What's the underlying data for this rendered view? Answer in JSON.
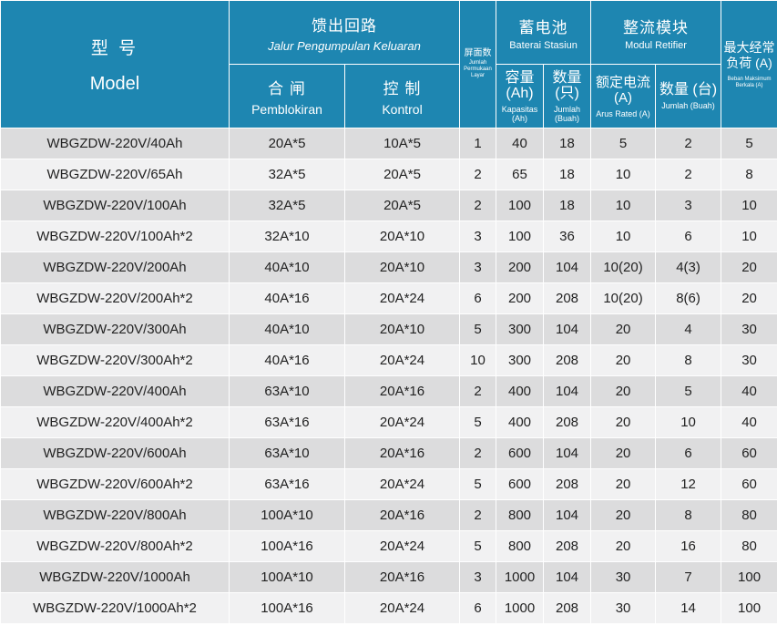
{
  "header": {
    "model_zh": "型 号",
    "model_en": "Model",
    "feeder_zh": "馈出回路",
    "feeder_en": "Jalur Pengumpulan Keluaran",
    "closing_zh": "合 闸",
    "closing_en": "Pemblokiran",
    "control_zh": "控 制",
    "control_en": "Kontrol",
    "panels_zh": "屏面数",
    "panels_en": "Jumlah Permukaan Layar",
    "battery_zh": "蓄电池",
    "battery_en": "Baterai Stasiun",
    "capacity_zh": "容量 (Ah)",
    "capacity_en": "Kapasitas (Ah)",
    "bat_qty_zh": "数量 (只)",
    "bat_qty_en": "Jumlah (Buah)",
    "rectifier_zh": "整流模块",
    "rectifier_en": "Modul Retifier",
    "rated_zh": "额定电流 (A)",
    "rated_en": "Arus Rated (A)",
    "rect_qty_zh": "数量 (台)",
    "rect_qty_en": "Jumlah (Buah)",
    "maxload_zh": "最大经常负荷 (A)",
    "maxload_en": "Beban Maksimum Berkala (A)"
  },
  "rows": [
    [
      "WBGZDW-220V/40Ah",
      "20A*5",
      "10A*5",
      "1",
      "40",
      "18",
      "5",
      "2",
      "5"
    ],
    [
      "WBGZDW-220V/65Ah",
      "32A*5",
      "20A*5",
      "2",
      "65",
      "18",
      "10",
      "2",
      "8"
    ],
    [
      "WBGZDW-220V/100Ah",
      "32A*5",
      "20A*5",
      "2",
      "100",
      "18",
      "10",
      "3",
      "10"
    ],
    [
      "WBGZDW-220V/100Ah*2",
      "32A*10",
      "20A*10",
      "3",
      "100",
      "36",
      "10",
      "6",
      "10"
    ],
    [
      "WBGZDW-220V/200Ah",
      "40A*10",
      "20A*10",
      "3",
      "200",
      "104",
      "10(20)",
      "4(3)",
      "20"
    ],
    [
      "WBGZDW-220V/200Ah*2",
      "40A*16",
      "20A*24",
      "6",
      "200",
      "208",
      "10(20)",
      "8(6)",
      "20"
    ],
    [
      "WBGZDW-220V/300Ah",
      "40A*10",
      "20A*10",
      "5",
      "300",
      "104",
      "20",
      "4",
      "30"
    ],
    [
      "WBGZDW-220V/300Ah*2",
      "40A*16",
      "20A*24",
      "10",
      "300",
      "208",
      "20",
      "8",
      "30"
    ],
    [
      "WBGZDW-220V/400Ah",
      "63A*10",
      "20A*16",
      "2",
      "400",
      "104",
      "20",
      "5",
      "40"
    ],
    [
      "WBGZDW-220V/400Ah*2",
      "63A*16",
      "20A*24",
      "5",
      "400",
      "208",
      "20",
      "10",
      "40"
    ],
    [
      "WBGZDW-220V/600Ah",
      "63A*10",
      "20A*16",
      "2",
      "600",
      "104",
      "20",
      "6",
      "60"
    ],
    [
      "WBGZDW-220V/600Ah*2",
      "63A*16",
      "20A*24",
      "5",
      "600",
      "208",
      "20",
      "12",
      "60"
    ],
    [
      "WBGZDW-220V/800Ah",
      "100A*10",
      "20A*16",
      "2",
      "800",
      "104",
      "20",
      "8",
      "80"
    ],
    [
      "WBGZDW-220V/800Ah*2",
      "100A*16",
      "20A*24",
      "5",
      "800",
      "208",
      "20",
      "16",
      "80"
    ],
    [
      "WBGZDW-220V/1000Ah",
      "100A*10",
      "20A*16",
      "3",
      "1000",
      "104",
      "30",
      "7",
      "100"
    ],
    [
      "WBGZDW-220V/1000Ah*2",
      "100A*16",
      "20A*24",
      "6",
      "1000",
      "208",
      "30",
      "14",
      "100"
    ]
  ]
}
